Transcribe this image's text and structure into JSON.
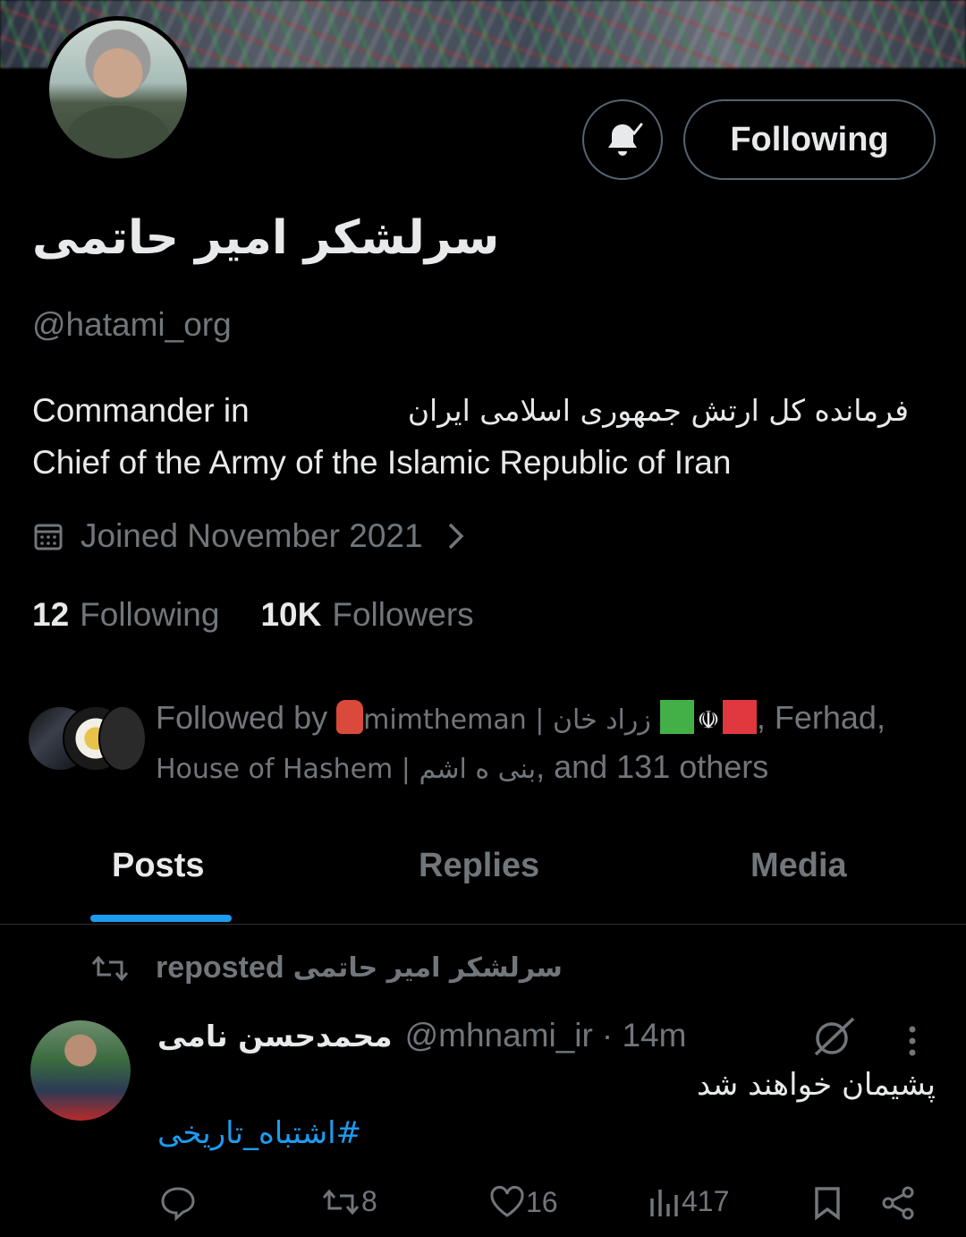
{
  "profile": {
    "display_name": "سرلشکر امیر حاتمی",
    "handle": "@hatami_org",
    "bio_en_part1": "Commander in",
    "bio_fa": "فرمانده کل ارتش جمهوری اسلامی ایران",
    "bio_en_part2": "Chief of the Army of the Islamic Republic of Iran",
    "joined": "Joined November 2021",
    "following_count": "12",
    "following_label": "Following",
    "followers_count": "10K",
    "followers_label": "Followers",
    "follow_button_label": "Following"
  },
  "followed_by": {
    "prefix": "Followed by",
    "user1": "mimtheman | زراد خان",
    "user2_suffix": ", Ferhad,",
    "user3": "House of Hashem | بنی ه اشم",
    "others": ", and 131 others"
  },
  "tabs": [
    {
      "label": "Posts"
    },
    {
      "label": "Replies"
    },
    {
      "label": "Media"
    }
  ],
  "post": {
    "repost_label": "reposted",
    "reposter": "سرلشکر امیر حاتمی",
    "author_name": "محمدحسن نامی",
    "author_handle": "@mhnami_ir",
    "time": "· 14m",
    "text": "پشیمان خواهند شد",
    "hashtag": "#اشتباه_تاریخی",
    "reposts": "8",
    "likes": "16",
    "views": "417"
  },
  "icons": {
    "bell": "bell-check-icon",
    "calendar": "calendar-icon",
    "chevron": "chevron-right-icon",
    "repost": "repost-icon",
    "reply": "reply-icon",
    "like": "heart-icon",
    "views": "views-icon",
    "bookmark": "bookmark-icon",
    "share": "share-icon",
    "grok": "grok-icon",
    "more": "more-icon"
  },
  "colors": {
    "accent": "#1d9bf0",
    "muted": "#71767b",
    "text": "#e7e9ea",
    "background": "#000000"
  }
}
